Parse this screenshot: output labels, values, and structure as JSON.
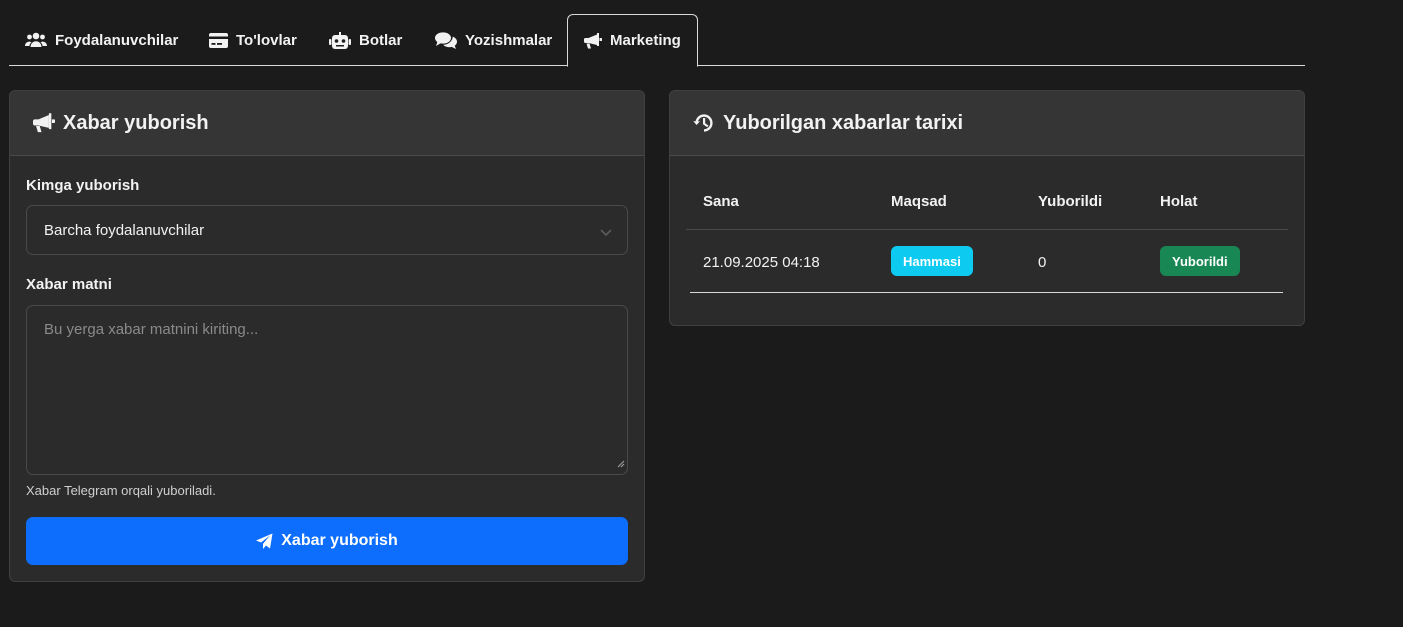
{
  "tabs": [
    {
      "label": "Foydalanuvchilar",
      "icon": "users-icon"
    },
    {
      "label": "To'lovlar",
      "icon": "credit-card-icon"
    },
    {
      "label": "Botlar",
      "icon": "robot-icon"
    },
    {
      "label": "Yozishmalar",
      "icon": "comments-icon"
    },
    {
      "label": "Marketing",
      "icon": "bullhorn-icon",
      "active": true
    }
  ],
  "send_form": {
    "title": "Xabar yuborish",
    "recipient_label": "Kimga yuborish",
    "recipient_value": "Barcha foydalanuvchilar",
    "message_label": "Xabar matni",
    "message_placeholder": "Bu yerga xabar matnini kiriting...",
    "message_value": "",
    "hint": "Xabar Telegram orqali yuboriladi.",
    "submit_label": "Xabar yuborish"
  },
  "history": {
    "title": "Yuborilgan xabarlar tarixi",
    "columns": [
      "Sana",
      "Maqsad",
      "Yuborildi",
      "Holat"
    ],
    "rows": [
      {
        "date": "21.09.2025 04:18",
        "target": "Hammasi",
        "sent": "0",
        "status": "Yuborildi"
      }
    ]
  },
  "colors": {
    "background": "#1b1b1b",
    "card": "#2b2b2b",
    "primary": "#0d6efd",
    "target_badge": "#0dcaf0",
    "status_badge": "#198754"
  }
}
